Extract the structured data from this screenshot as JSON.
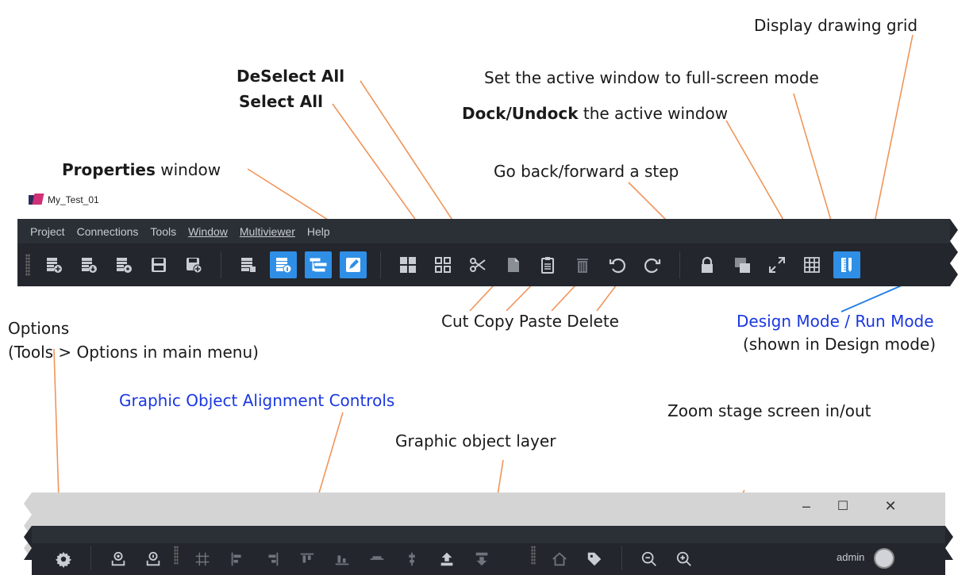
{
  "callouts": {
    "display_grid": "Display drawing grid",
    "fullscreen": "Set the active window to full-screen mode",
    "deselect_all": "DeSelect All",
    "select_all": "Select All",
    "dock_bold": "Dock/Undock",
    "dock_rest": " the active window",
    "properties_bold": "Properties",
    "properties_rest": " window",
    "go_back": "Go back/forward a step",
    "cut_copy": "Cut Copy Paste Delete",
    "design_mode": "Design Mode / Run Mode",
    "design_mode_note": "(shown in Design mode)",
    "options": "Options",
    "options_note": "(Tools > Options in main menu)",
    "alignment": "Graphic Object Alignment Controls",
    "layer": "Graphic object layer",
    "zoom": "Zoom stage screen in/out"
  },
  "window": {
    "title": "My_Test_01",
    "menu": [
      "Project",
      "Connections",
      "Tools",
      "Window",
      "Multiviewer",
      "Help"
    ]
  },
  "toolbar_icons": [
    "new-project-icon",
    "open-project-icon",
    "project-settings-icon",
    "save-icon",
    "save-as-icon",
    "log-icon",
    "info-panel-icon",
    "tree-view-icon",
    "properties-icon",
    "select-all-icon",
    "deselect-all-icon",
    "cut-icon",
    "copy-icon",
    "paste-icon",
    "delete-icon",
    "undo-icon",
    "redo-icon",
    "lock-icon",
    "dock-icon",
    "fullscreen-icon",
    "grid-icon",
    "design-mode-icon"
  ],
  "bottom": {
    "window_controls": [
      "–",
      "☐",
      "✕"
    ],
    "user": "admin"
  },
  "colors": {
    "accent": "#2f8fe6",
    "callout_line": "#f0955a",
    "blue_line": "#1e7be6",
    "blue_text": "#1a37e0"
  }
}
